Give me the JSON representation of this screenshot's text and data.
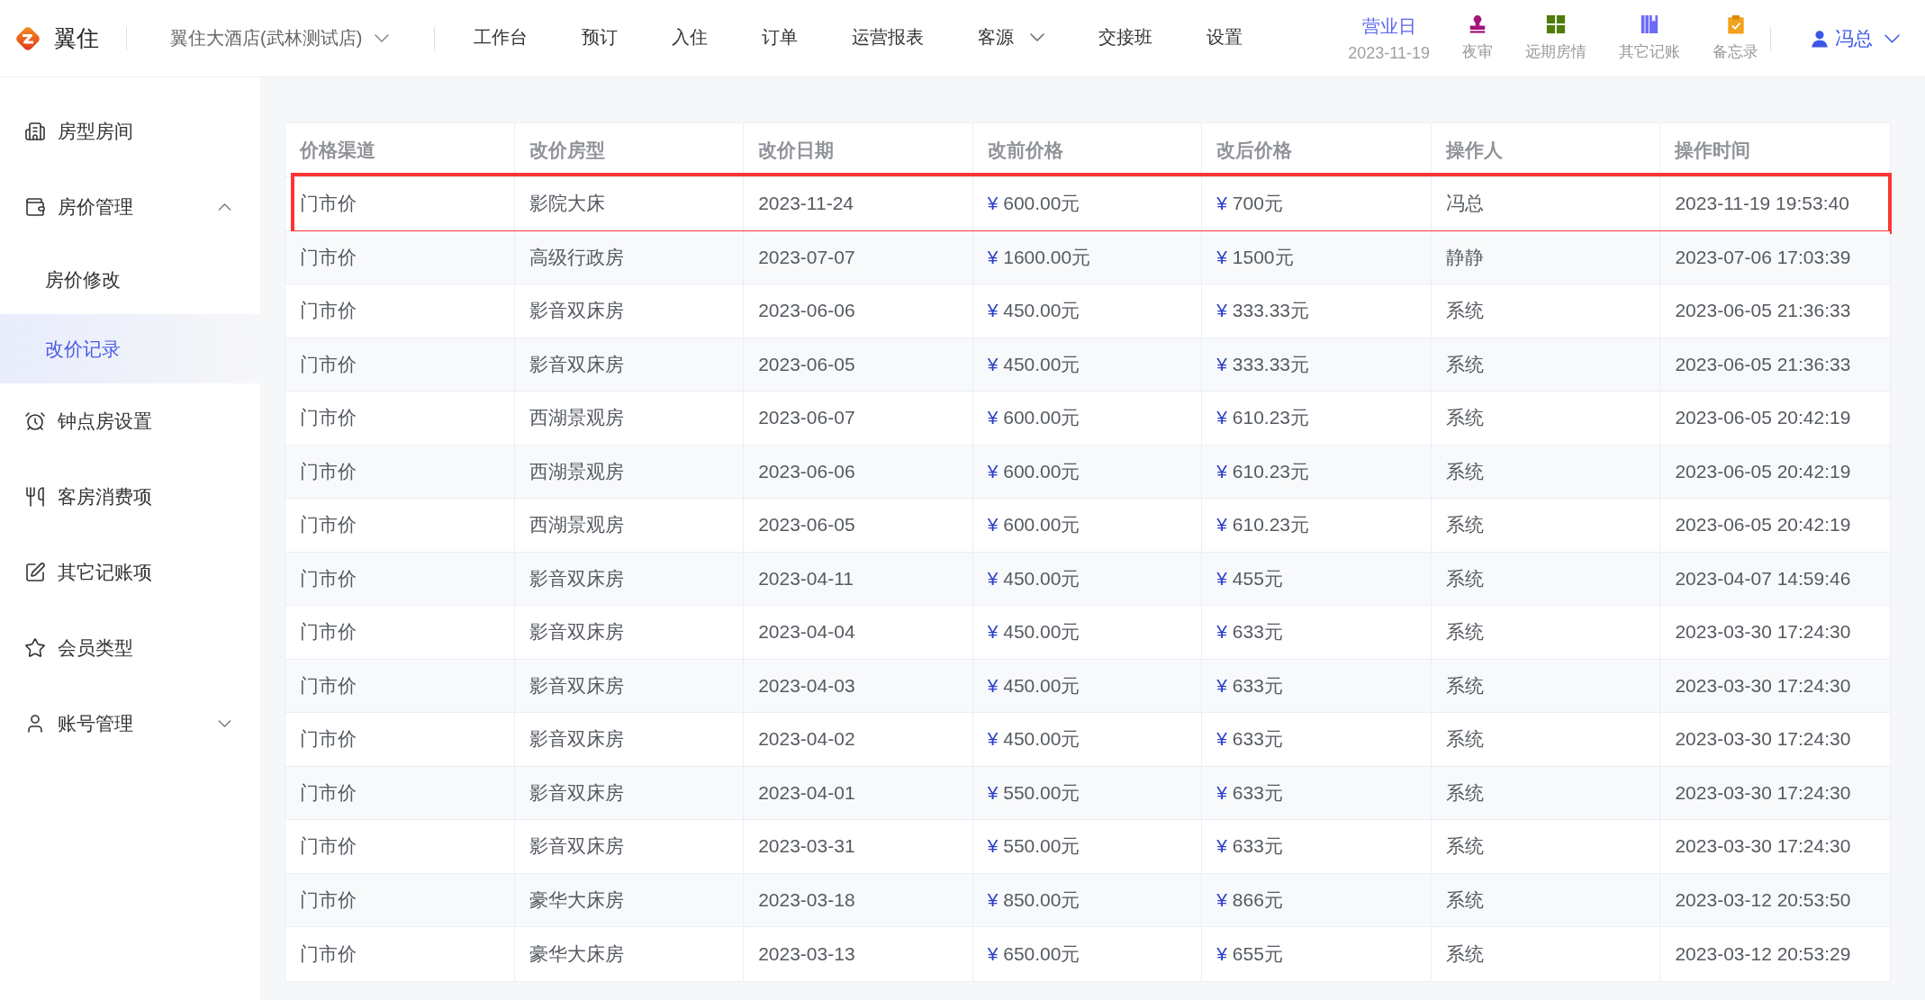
{
  "header": {
    "brand": "翼住",
    "hotel": "翼住大酒店(武林测试店)",
    "nav": [
      {
        "label": "工作台",
        "kind": "link",
        "selected": false
      },
      {
        "label": "预订",
        "kind": "link",
        "selected": false
      },
      {
        "label": "入住",
        "kind": "link",
        "selected": false
      },
      {
        "label": "订单",
        "kind": "link",
        "selected": false
      },
      {
        "label": "运营报表",
        "kind": "link",
        "selected": false
      },
      {
        "label": "客源",
        "kind": "menu",
        "selected": false
      },
      {
        "label": "交接班",
        "kind": "link",
        "selected": false
      },
      {
        "label": "设置",
        "kind": "link",
        "selected": false
      }
    ],
    "business_day": {
      "label": "营业日",
      "date": "2023-11-19"
    },
    "shortcuts": [
      {
        "label": "夜审"
      },
      {
        "label": "远期房情"
      },
      {
        "label": "其它记账"
      },
      {
        "label": "备忘录"
      }
    ],
    "user": {
      "name": "冯总"
    }
  },
  "sidebar": {
    "items": [
      {
        "label": "房型房间",
        "kind": "link",
        "selected": false
      },
      {
        "label": "房价管理",
        "kind": "group",
        "expanded": true,
        "children": [
          {
            "label": "房价修改",
            "selected": false
          },
          {
            "label": "改价记录",
            "selected": true
          }
        ]
      },
      {
        "label": "钟点房设置",
        "kind": "link",
        "selected": false
      },
      {
        "label": "客房消费项",
        "kind": "link",
        "selected": false
      },
      {
        "label": "其它记账项",
        "kind": "link",
        "selected": false
      },
      {
        "label": "会员类型",
        "kind": "link",
        "selected": false
      },
      {
        "label": "账号管理",
        "kind": "group",
        "expanded": false
      }
    ]
  },
  "table": {
    "columns": [
      "价格渠道",
      "改价房型",
      "改价日期",
      "改前价格",
      "改后价格",
      "操作人",
      "操作时间"
    ],
    "rows": [
      {
        "channel": "门市价",
        "room_type": "影院大床",
        "date": "2023-11-24",
        "price_before": {
          "currency": "¥",
          "amount": "600.00元"
        },
        "price_after": {
          "currency": "¥",
          "amount": "700元"
        },
        "operator": "冯总",
        "time": "2023-11-19 19:53:40",
        "marked": true
      },
      {
        "channel": "门市价",
        "room_type": "高级行政房",
        "date": "2023-07-07",
        "price_before": {
          "currency": "¥",
          "amount": "1600.00元"
        },
        "price_after": {
          "currency": "¥",
          "amount": "1500元"
        },
        "operator": "静静",
        "time": "2023-07-06 17:03:39",
        "marked": false
      },
      {
        "channel": "门市价",
        "room_type": "影音双床房",
        "date": "2023-06-06",
        "price_before": {
          "currency": "¥",
          "amount": "450.00元"
        },
        "price_after": {
          "currency": "¥",
          "amount": "333.33元"
        },
        "operator": "系统",
        "time": "2023-06-05 21:36:33",
        "marked": false
      },
      {
        "channel": "门市价",
        "room_type": "影音双床房",
        "date": "2023-06-05",
        "price_before": {
          "currency": "¥",
          "amount": "450.00元"
        },
        "price_after": {
          "currency": "¥",
          "amount": "333.33元"
        },
        "operator": "系统",
        "time": "2023-06-05 21:36:33",
        "marked": false
      },
      {
        "channel": "门市价",
        "room_type": "西湖景观房",
        "date": "2023-06-07",
        "price_before": {
          "currency": "¥",
          "amount": "600.00元"
        },
        "price_after": {
          "currency": "¥",
          "amount": "610.23元"
        },
        "operator": "系统",
        "time": "2023-06-05 20:42:19",
        "marked": false
      },
      {
        "channel": "门市价",
        "room_type": "西湖景观房",
        "date": "2023-06-06",
        "price_before": {
          "currency": "¥",
          "amount": "600.00元"
        },
        "price_after": {
          "currency": "¥",
          "amount": "610.23元"
        },
        "operator": "系统",
        "time": "2023-06-05 20:42:19",
        "marked": false
      },
      {
        "channel": "门市价",
        "room_type": "西湖景观房",
        "date": "2023-06-05",
        "price_before": {
          "currency": "¥",
          "amount": "600.00元"
        },
        "price_after": {
          "currency": "¥",
          "amount": "610.23元"
        },
        "operator": "系统",
        "time": "2023-06-05 20:42:19",
        "marked": false
      },
      {
        "channel": "门市价",
        "room_type": "影音双床房",
        "date": "2023-04-11",
        "price_before": {
          "currency": "¥",
          "amount": "450.00元"
        },
        "price_after": {
          "currency": "¥",
          "amount": "455元"
        },
        "operator": "系统",
        "time": "2023-04-07 14:59:46",
        "marked": false
      },
      {
        "channel": "门市价",
        "room_type": "影音双床房",
        "date": "2023-04-04",
        "price_before": {
          "currency": "¥",
          "amount": "450.00元"
        },
        "price_after": {
          "currency": "¥",
          "amount": "633元"
        },
        "operator": "系统",
        "time": "2023-03-30 17:24:30",
        "marked": false
      },
      {
        "channel": "门市价",
        "room_type": "影音双床房",
        "date": "2023-04-03",
        "price_before": {
          "currency": "¥",
          "amount": "450.00元"
        },
        "price_after": {
          "currency": "¥",
          "amount": "633元"
        },
        "operator": "系统",
        "time": "2023-03-30 17:24:30",
        "marked": false
      },
      {
        "channel": "门市价",
        "room_type": "影音双床房",
        "date": "2023-04-02",
        "price_before": {
          "currency": "¥",
          "amount": "450.00元"
        },
        "price_after": {
          "currency": "¥",
          "amount": "633元"
        },
        "operator": "系统",
        "time": "2023-03-30 17:24:30",
        "marked": false
      },
      {
        "channel": "门市价",
        "room_type": "影音双床房",
        "date": "2023-04-01",
        "price_before": {
          "currency": "¥",
          "amount": "550.00元"
        },
        "price_after": {
          "currency": "¥",
          "amount": "633元"
        },
        "operator": "系统",
        "time": "2023-03-30 17:24:30",
        "marked": false
      },
      {
        "channel": "门市价",
        "room_type": "影音双床房",
        "date": "2023-03-31",
        "price_before": {
          "currency": "¥",
          "amount": "550.00元"
        },
        "price_after": {
          "currency": "¥",
          "amount": "633元"
        },
        "operator": "系统",
        "time": "2023-03-30 17:24:30",
        "marked": false
      },
      {
        "channel": "门市价",
        "room_type": "豪华大床房",
        "date": "2023-03-18",
        "price_before": {
          "currency": "¥",
          "amount": "850.00元"
        },
        "price_after": {
          "currency": "¥",
          "amount": "866元"
        },
        "operator": "系统",
        "time": "2023-03-12 20:53:50",
        "marked": false
      },
      {
        "channel": "门市价",
        "room_type": "豪华大床房",
        "date": "2023-03-13",
        "price_before": {
          "currency": "¥",
          "amount": "650.00元"
        },
        "price_after": {
          "currency": "¥",
          "amount": "655元"
        },
        "operator": "系统",
        "time": "2023-03-12 20:53:29",
        "marked": false
      }
    ]
  }
}
